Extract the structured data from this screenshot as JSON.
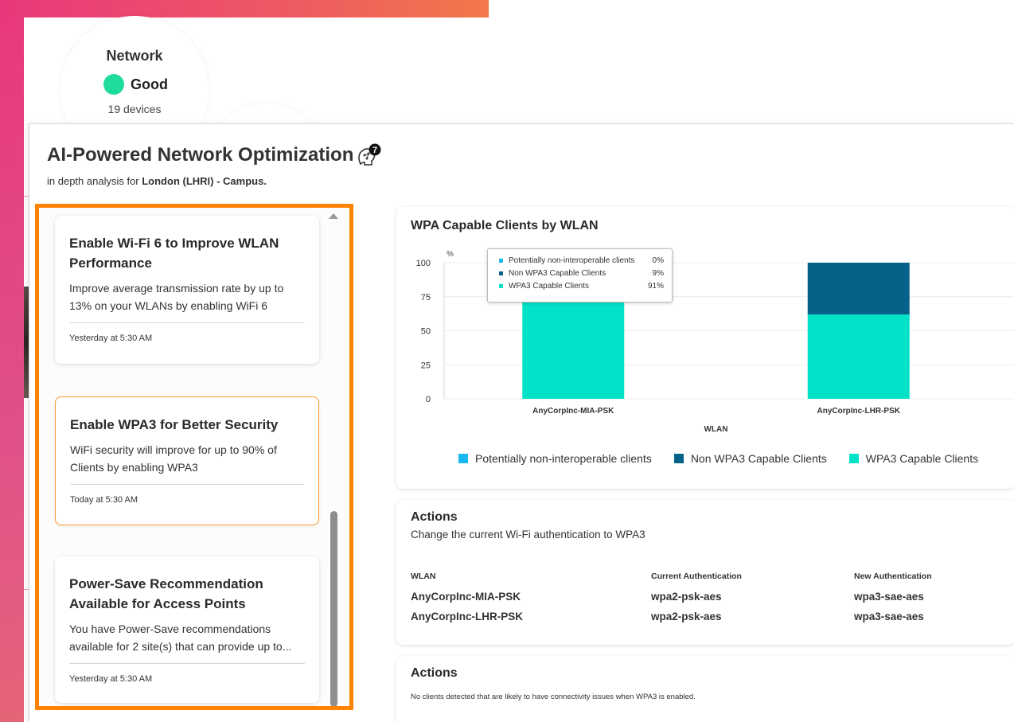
{
  "background": {
    "network_card": {
      "title": "Network",
      "status": "Good",
      "devices": "19 devices"
    }
  },
  "modal": {
    "title": "AI-Powered Network Optimization",
    "badge_count": "7",
    "subtitle_prefix": "in depth analysis for ",
    "subtitle_location": "London (LHRI) - Campus."
  },
  "recommendations": [
    {
      "title": "Enable Wi-Fi 6 to Improve WLAN Performance",
      "description": "Improve average transmission rate by up to 13% on your WLANs by enabling WiFi 6",
      "time": "Yesterday at 5:30 AM",
      "selected": false
    },
    {
      "title": "Enable WPA3 for Better Security",
      "description": "WiFi security will improve for up to 90% of Clients by enabling WPA3",
      "time": "Today at 5:30 AM",
      "selected": true
    },
    {
      "title": "Power-Save Recommendation Available for Access Points",
      "description": "You have Power-Save recommendations available for 2 site(s) that can provide up to...",
      "time": "Yesterday at 5:30 AM",
      "selected": false
    }
  ],
  "chart_panel": {
    "title": "WPA Capable Clients by WLAN"
  },
  "chart_data": {
    "type": "bar",
    "stacked": true,
    "title": "WPA Capable Clients by WLAN",
    "xlabel": "WLAN",
    "ylabel": "%",
    "ylim": [
      0,
      100
    ],
    "yticks": [
      0,
      25,
      50,
      75,
      100
    ],
    "categories": [
      "AnyCorpInc-MIA-PSK",
      "AnyCorpInc-LHR-PSK"
    ],
    "series": [
      {
        "name": "Potentially non-interoperable clients",
        "color": "#1ab8f0",
        "values": [
          0,
          0
        ]
      },
      {
        "name": "Non WPA3 Capable Clients",
        "color": "#07628a",
        "values": [
          9,
          38
        ]
      },
      {
        "name": "WPA3 Capable Clients",
        "color": "#01e2c8",
        "values": [
          91,
          62
        ]
      }
    ],
    "grid": true,
    "legend_position": "bottom",
    "tooltip": {
      "category": "AnyCorpInc-MIA-PSK",
      "rows": [
        {
          "label": "Potentially non-interoperable clients",
          "value": "0%",
          "color": "#1ab8f0"
        },
        {
          "label": "Non WPA3 Capable Clients",
          "value": "9%",
          "color": "#07628a"
        },
        {
          "label": "WPA3 Capable Clients",
          "value": "91%",
          "color": "#01e2c8"
        }
      ]
    }
  },
  "actions_panel": {
    "title": "Actions",
    "subtitle": "Change the current Wi-Fi authentication to WPA3",
    "columns": [
      "WLAN",
      "Current Authentication",
      "New Authentication"
    ],
    "rows": [
      [
        "AnyCorpInc-MIA-PSK",
        "wpa2-psk-aes",
        "wpa3-sae-aes"
      ],
      [
        "AnyCorpInc-LHR-PSK",
        "wpa2-psk-aes",
        "wpa3-sae-aes"
      ]
    ]
  },
  "actions_panel_2": {
    "title": "Actions",
    "note": "No clients detected that are likely to have connectivity issues when WPA3 is enabled."
  },
  "colors": {
    "highlight": "#ff8300",
    "status_good": "#1fdc9a"
  }
}
